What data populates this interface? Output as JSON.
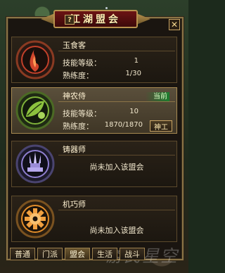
{
  "window": {
    "title": "江湖盟会",
    "help_label": "?",
    "close_label": "✕"
  },
  "guilds": [
    {
      "name": "玉食客",
      "emblem_icon": "flame-emblem-icon",
      "emblem_color": "#c2402a",
      "skill_level_label": "技能等级：",
      "skill_level": "1",
      "proficiency_label": "熟练度：",
      "proficiency": "1/30"
    },
    {
      "name": "神农侍",
      "emblem_icon": "leaf-emblem-icon",
      "emblem_color": "#7fb23a",
      "current_label": "当前",
      "skill_level_label": "技能等级：",
      "skill_level": "10",
      "proficiency_label": "熟练度：",
      "proficiency": "1870/1870",
      "action_label": "神工"
    },
    {
      "name": "铸器师",
      "emblem_icon": "forge-emblem-icon",
      "emblem_color": "#8f7fd0",
      "status": "尚未加入该盟会"
    },
    {
      "name": "机巧师",
      "emblem_icon": "gear-emblem-icon",
      "emblem_color": "#e08c2a",
      "status": "尚未加入该盟会"
    }
  ],
  "tabs": [
    {
      "label": "普通",
      "active": false
    },
    {
      "label": "门派",
      "active": false
    },
    {
      "label": "盟会",
      "active": true
    },
    {
      "label": "生活",
      "active": false
    },
    {
      "label": "战斗",
      "active": false
    }
  ],
  "watermark": "游民星空"
}
